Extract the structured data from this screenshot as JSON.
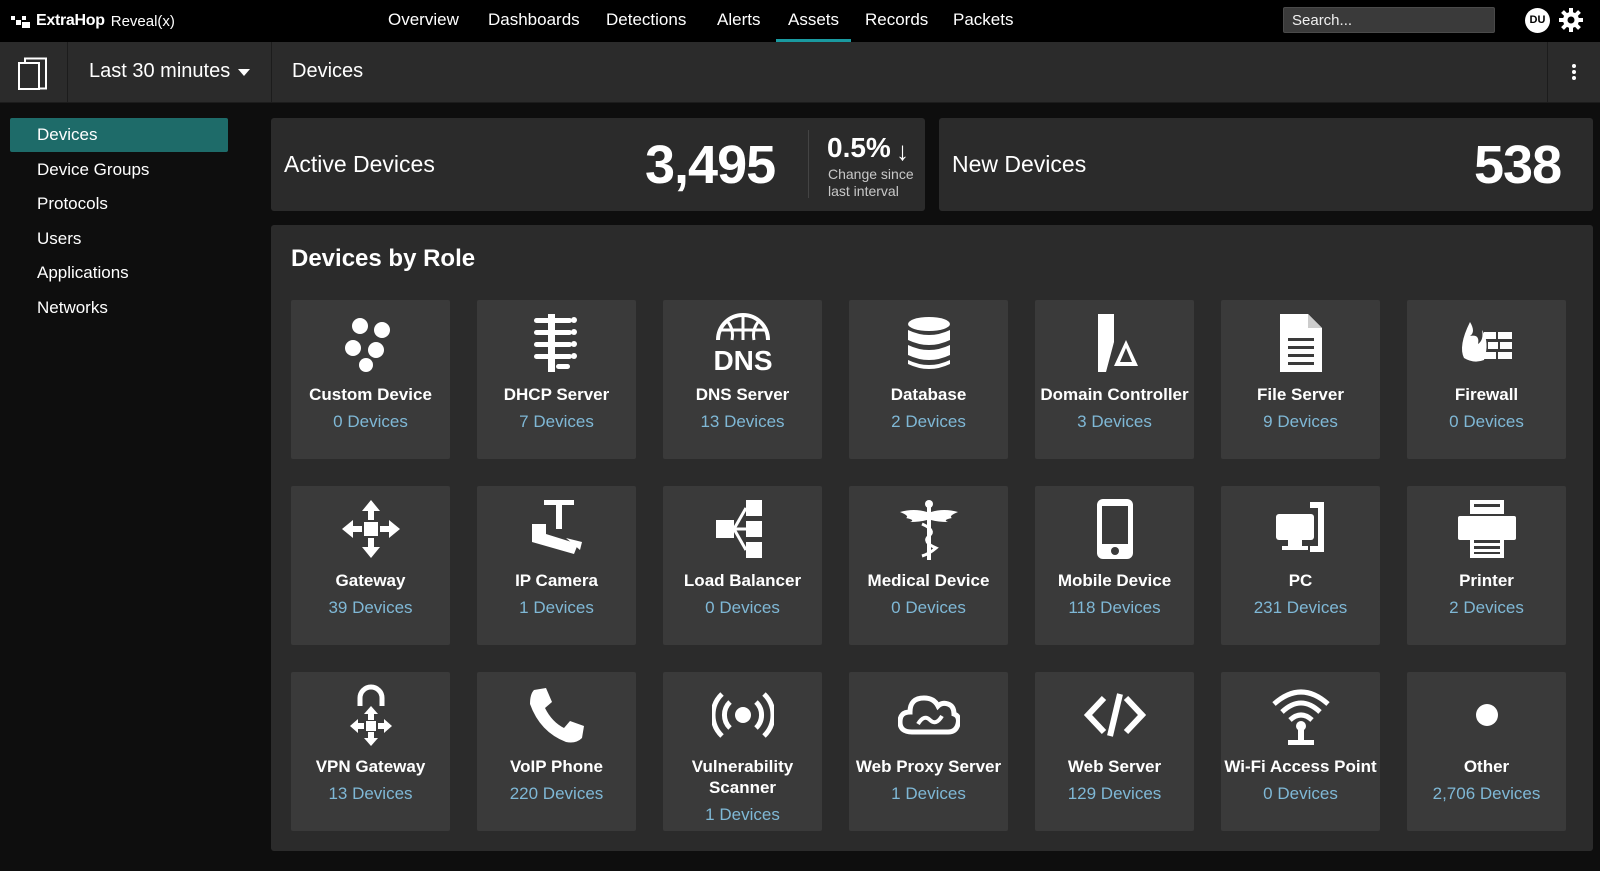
{
  "app": {
    "brand": "ExtraHop",
    "product": "Reveal(x)"
  },
  "nav": {
    "tabs": [
      {
        "label": "Overview"
      },
      {
        "label": "Dashboards"
      },
      {
        "label": "Detections"
      },
      {
        "label": "Alerts"
      },
      {
        "label": "Assets",
        "active": true
      },
      {
        "label": "Records"
      },
      {
        "label": "Packets"
      }
    ],
    "search_placeholder": "Search...",
    "user_initials": "DU"
  },
  "subheader": {
    "time_range": "Last 30 minutes",
    "page_title": "Devices"
  },
  "sidebar": {
    "items": [
      {
        "label": "Devices",
        "active": true
      },
      {
        "label": "Device Groups"
      },
      {
        "label": "Protocols"
      },
      {
        "label": "Users"
      },
      {
        "label": "Applications"
      },
      {
        "label": "Networks"
      }
    ]
  },
  "stats": {
    "active_devices": {
      "label": "Active Devices",
      "value": "3,495",
      "change": "0.5%",
      "change_arrow": "↓",
      "change_desc": "Change since last interval"
    },
    "new_devices": {
      "label": "New Devices",
      "value": "538"
    }
  },
  "roles": {
    "title": "Devices by Role",
    "items": [
      {
        "name": "Custom Device",
        "count": "0 Devices",
        "icon": "custom-device-icon"
      },
      {
        "name": "DHCP Server",
        "count": "7 Devices",
        "icon": "dhcp-server-icon"
      },
      {
        "name": "DNS Server",
        "count": "13 Devices",
        "icon": "dns-server-icon",
        "icon_text": "DNS"
      },
      {
        "name": "Database",
        "count": "2 Devices",
        "icon": "database-icon"
      },
      {
        "name": "Domain Controller",
        "count": "3 Devices",
        "icon": "domain-controller-icon"
      },
      {
        "name": "File Server",
        "count": "9 Devices",
        "icon": "file-server-icon"
      },
      {
        "name": "Firewall",
        "count": "0 Devices",
        "icon": "firewall-icon"
      },
      {
        "name": "Gateway",
        "count": "39 Devices",
        "icon": "gateway-icon"
      },
      {
        "name": "IP Camera",
        "count": "1 Devices",
        "icon": "ip-camera-icon"
      },
      {
        "name": "Load Balancer",
        "count": "0 Devices",
        "icon": "load-balancer-icon"
      },
      {
        "name": "Medical Device",
        "count": "0 Devices",
        "icon": "medical-device-icon"
      },
      {
        "name": "Mobile Device",
        "count": "118 Devices",
        "icon": "mobile-device-icon"
      },
      {
        "name": "PC",
        "count": "231 Devices",
        "icon": "pc-icon"
      },
      {
        "name": "Printer",
        "count": "2 Devices",
        "icon": "printer-icon"
      },
      {
        "name": "VPN Gateway",
        "count": "13 Devices",
        "icon": "vpn-gateway-icon"
      },
      {
        "name": "VoIP Phone",
        "count": "220 Devices",
        "icon": "voip-phone-icon"
      },
      {
        "name": "Vulnerability Scanner",
        "count": "1 Devices",
        "icon": "vulnerability-scanner-icon"
      },
      {
        "name": "Web Proxy Server",
        "count": "1 Devices",
        "icon": "web-proxy-server-icon"
      },
      {
        "name": "Web Server",
        "count": "129 Devices",
        "icon": "web-server-icon"
      },
      {
        "name": "Wi-Fi Access Point",
        "count": "0 Devices",
        "icon": "wifi-access-point-icon"
      },
      {
        "name": "Other",
        "count": "2,706 Devices",
        "icon": "other-icon"
      }
    ]
  },
  "colors": {
    "accent": "#1a9aa0",
    "sidebar_active": "#1e6b69",
    "count_link": "#7fb8d6",
    "card_bg": "#2b2b2b",
    "tile_bg": "#3a3a3a"
  }
}
